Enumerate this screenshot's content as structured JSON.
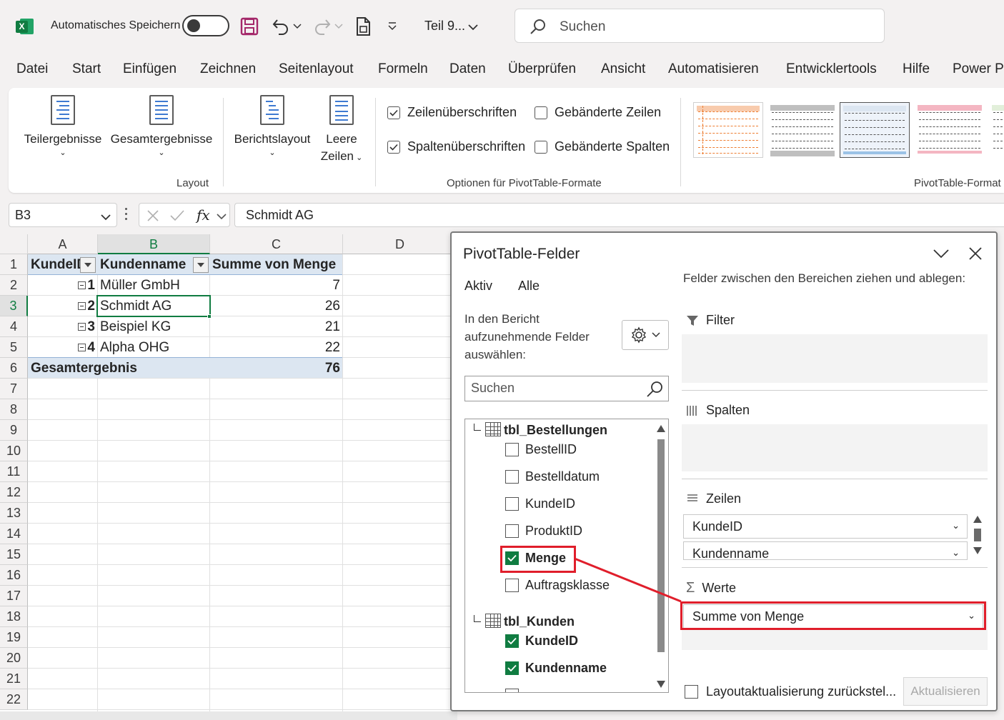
{
  "titlebar": {
    "autosave_label": "Automatisches Speichern",
    "file_title": "Teil 9...",
    "search_placeholder": "Suchen"
  },
  "menu": [
    "Datei",
    "Start",
    "Einfügen",
    "Zeichnen",
    "Seitenlayout",
    "Formeln",
    "Daten",
    "Überprüfen",
    "Ansicht",
    "Automatisieren",
    "Entwicklertools",
    "Hilfe",
    "Power Pi"
  ],
  "ribbon": {
    "teilergebnisse": "Teilergebnisse",
    "gesamtergebnisse": "Gesamtergebnisse",
    "berichtslayout": "Berichtslayout",
    "leere_zeilen_1": "Leere",
    "leere_zeilen_2": "Zeilen",
    "group_layout": "Layout",
    "zeilenueberschriften": "Zeilenüberschriften",
    "spaltenueberschriften": "Spaltenüberschriften",
    "gebaenderte_zeilen": "Gebänderte Zeilen",
    "gebaenderte_spalten": "Gebänderte Spalten",
    "group_optionen": "Optionen für PivotTable-Formate",
    "group_formate": "PivotTable-Format"
  },
  "formula_bar": {
    "name_box": "B3",
    "fx": "fx",
    "formula": "Schmidt AG"
  },
  "sheet": {
    "columns": [
      "A",
      "B",
      "C",
      "D"
    ],
    "rows": [
      "1",
      "2",
      "3",
      "4",
      "5",
      "6",
      "7",
      "8",
      "9",
      "10",
      "11",
      "12",
      "13",
      "14",
      "15",
      "16",
      "17",
      "18",
      "19",
      "20",
      "21",
      "22"
    ],
    "headers": {
      "a": "KundeID",
      "b": "Kundenname",
      "c": "Summe von Menge"
    },
    "data": [
      {
        "id": "1",
        "name": "Müller GmbH",
        "sum": "7"
      },
      {
        "id": "2",
        "name": "Schmidt AG",
        "sum": "26"
      },
      {
        "id": "3",
        "name": "Beispiel KG",
        "sum": "21"
      },
      {
        "id": "4",
        "name": "Alpha OHG",
        "sum": "22"
      }
    ],
    "total_label": "Gesamtergebnis",
    "total_value": "76"
  },
  "pivot_pane": {
    "title": "PivotTable-Felder",
    "tab_active": "Aktiv",
    "tab_all": "Alle",
    "instructions": "In den Bericht aufzunehmende Felder auswählen:",
    "search_placeholder": "Suchen",
    "table1": "tbl_Bestellungen",
    "table1_fields": [
      {
        "label": "BestellID",
        "checked": false
      },
      {
        "label": "Bestelldatum",
        "checked": false
      },
      {
        "label": "KundeID",
        "checked": false
      },
      {
        "label": "ProduktID",
        "checked": false
      },
      {
        "label": "Menge",
        "checked": true
      },
      {
        "label": "Auftragsklasse",
        "checked": false
      }
    ],
    "table2": "tbl_Kunden",
    "table2_fields": [
      {
        "label": "KundeID",
        "checked": true
      },
      {
        "label": "Kundenname",
        "checked": true
      }
    ],
    "drag_text": "Felder zwischen den Bereichen ziehen und ablegen:",
    "area_filter": "Filter",
    "area_columns": "Spalten",
    "area_rows": "Zeilen",
    "area_values": "Werte",
    "rows_fields": [
      "KundeID",
      "Kundenname"
    ],
    "values_fields": [
      "Summe von Menge"
    ],
    "defer_label": "Layoutaktualisierung zurückstel...",
    "update_button": "Aktualisieren"
  },
  "colors": {
    "excel_green": "#107c41",
    "pivot_header": "#dce6f1",
    "highlight_red": "#e01e2b"
  }
}
